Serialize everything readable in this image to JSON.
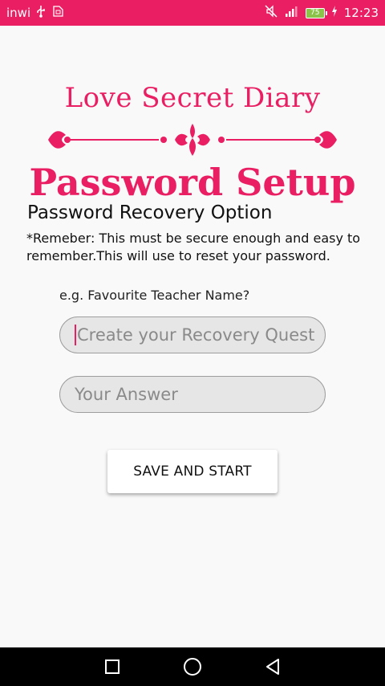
{
  "status_bar": {
    "carrier": "inwi",
    "battery": "75",
    "time": "12:23",
    "icons": [
      "usb-icon",
      "sim-icon",
      "mute-icon",
      "signal-icon",
      "battery-icon",
      "charging-icon"
    ]
  },
  "header": {
    "app_title": "Love Secret Diary",
    "page_title": "Password Setup"
  },
  "recovery": {
    "section_title": "Password Recovery Option",
    "note": "*Remeber: This must be secure enough and easy to remember.This will use to reset your password.",
    "example": "e.g. Favourite Teacher Name?",
    "question_placeholder": "Create your Recovery Quest",
    "answer_placeholder": "Your Answer"
  },
  "actions": {
    "save_label": "SAVE AND START"
  },
  "nav": {
    "icons": [
      "recents-square-icon",
      "home-circle-icon",
      "back-triangle-icon"
    ]
  },
  "colors": {
    "accent": "#e91e63",
    "background": "#f9f9f9",
    "field_bg": "#e6e6e6"
  }
}
